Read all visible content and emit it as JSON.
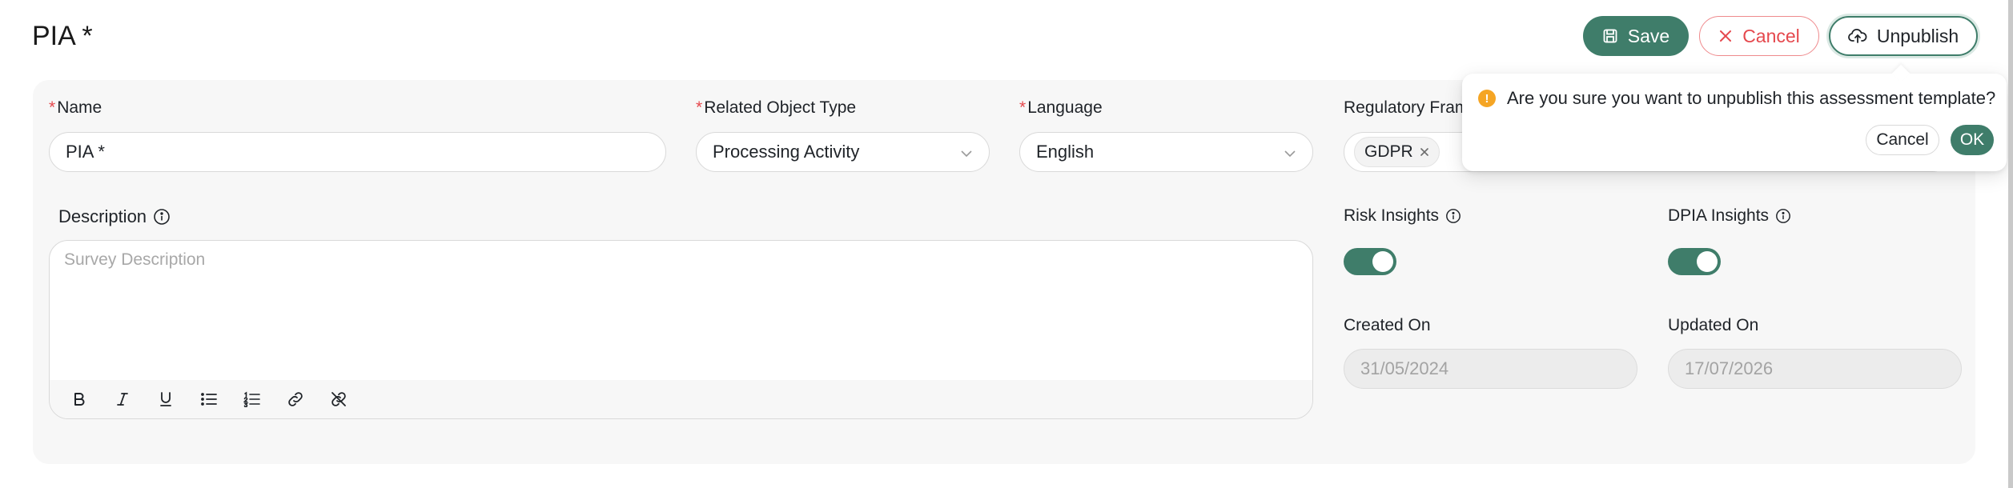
{
  "page": {
    "title": "PIA *"
  },
  "header_actions": {
    "save": "Save",
    "cancel": "Cancel",
    "unpublish": "Unpublish"
  },
  "form": {
    "name": {
      "label": "Name",
      "value": "PIA *"
    },
    "related_object_type": {
      "label": "Related Object Type",
      "value": "Processing Activity"
    },
    "language": {
      "label": "Language",
      "value": "English"
    },
    "regulatory_framework": {
      "label": "Regulatory Fram",
      "tags": [
        "GDPR"
      ]
    },
    "description": {
      "label": "Description",
      "placeholder": "Survey Description"
    },
    "risk_insights": {
      "label": "Risk Insights",
      "enabled": true
    },
    "dpia_insights": {
      "label": "DPIA Insights",
      "enabled": true
    },
    "created_on": {
      "label": "Created On",
      "value": "31/05/2024"
    },
    "updated_on": {
      "label": "Updated On",
      "value": "17/07/2026"
    }
  },
  "editor_toolbar": [
    "bold-icon",
    "italic-icon",
    "underline-icon",
    "bullet-list-icon",
    "numbered-list-icon",
    "link-icon",
    "unlink-icon"
  ],
  "popconfirm": {
    "message": "Are you sure you want to unpublish this assessment template?",
    "cancel": "Cancel",
    "ok": "OK"
  },
  "colors": {
    "primary": "#3f7d6a",
    "danger": "#e5484d",
    "warning": "#f5a524"
  }
}
